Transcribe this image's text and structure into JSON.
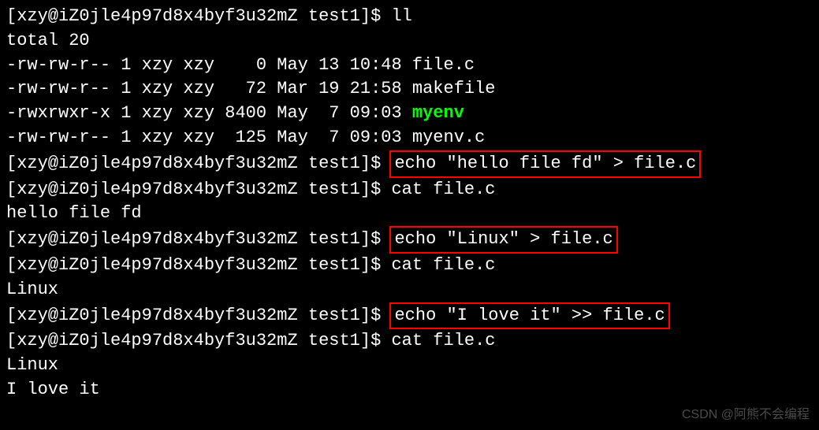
{
  "prompt": "[xzy@iZ0jle4p97d8x4byf3u32mZ test1]$ ",
  "cmd": {
    "ll": "ll",
    "echo1": "echo \"hello file fd\" > file.c",
    "cat": "cat file.c",
    "echo2": "echo \"Linux\" > file.c",
    "echo3": "echo \"I love it\" >> file.c"
  },
  "out": {
    "total": "total 20",
    "f1": "-rw-rw-r-- 1 xzy xzy    0 May 13 10:48 file.c",
    "f2": "-rw-rw-r-- 1 xzy xzy   72 Mar 19 21:58 makefile",
    "f3a": "-rwxrwxr-x 1 xzy xzy 8400 May  7 09:03 ",
    "f3b": "myenv",
    "f4": "-rw-rw-r-- 1 xzy xzy  125 May  7 09:03 myenv.c",
    "cat1": "hello file fd",
    "cat2": "Linux",
    "cat3a": "Linux",
    "cat3b": "I love it"
  },
  "watermark": "CSDN @阿熊不会编程"
}
